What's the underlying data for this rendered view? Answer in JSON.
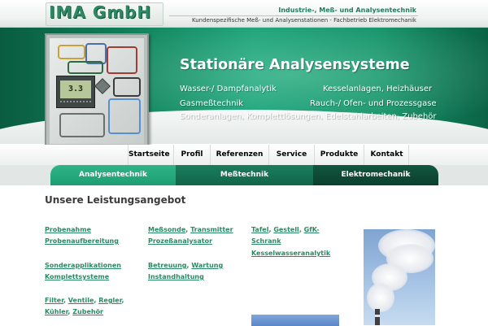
{
  "header": {
    "logo": "IMA GmbH",
    "tagline": "Industrie-, Meß- und Analysentechnik",
    "subline": "Kundenspezifische Meß- und Analysenstationen - Fachbetrieb Elektromechanik"
  },
  "banner": {
    "title": "Stationäre Analysensysteme",
    "device_display": "3.3",
    "lines": [
      {
        "left": "Wasser-/ Dampfanalytik",
        "right": "Kesselanlagen, Heizhäuser"
      },
      {
        "left": "Gasmeßtechnik",
        "right": "Rauch-/ Ofen- und Prozessgase"
      },
      {
        "full": "Sonderanlagen, Komplettlösungen, Edelstahlarbeiten, Zubehör"
      }
    ]
  },
  "nav": {
    "items": [
      "Startseite",
      "Profil",
      "Referenzen",
      "Service",
      "Produkte",
      "Kontakt"
    ],
    "active": "Startseite"
  },
  "subnav": {
    "items": [
      "Analysentechnik",
      "Meßtechnik",
      "Elektromechanik"
    ]
  },
  "content": {
    "title": "Unsere Leistungsangebot",
    "col1": {
      "g1": [
        "Probenahme",
        "Probenaufbereitung"
      ],
      "g2": [
        "Sonderapplikationen",
        "Komplettsysteme"
      ],
      "g3": [
        "Filter",
        "Ventile",
        "Regler",
        "Kühler",
        "Zubehör"
      ]
    },
    "col2": {
      "g1": [
        "Meßsonde",
        "Transmitter",
        "Prozeßanalysator"
      ],
      "g2": [
        "Betreuung",
        "Wartung",
        "Instandhaltung"
      ]
    },
    "col3": {
      "g1": [
        "Tafel",
        "Gestell",
        "GfK-Schrank"
      ],
      "g2": [
        "Kesselwasseranalytik"
      ]
    }
  },
  "colors": {
    "brand_green": "#2a8a63",
    "banner_green": "#18a076",
    "subnav_1": "#1c9e73",
    "subnav_2": "#12654a",
    "subnav_3": "#0b3f2e"
  }
}
